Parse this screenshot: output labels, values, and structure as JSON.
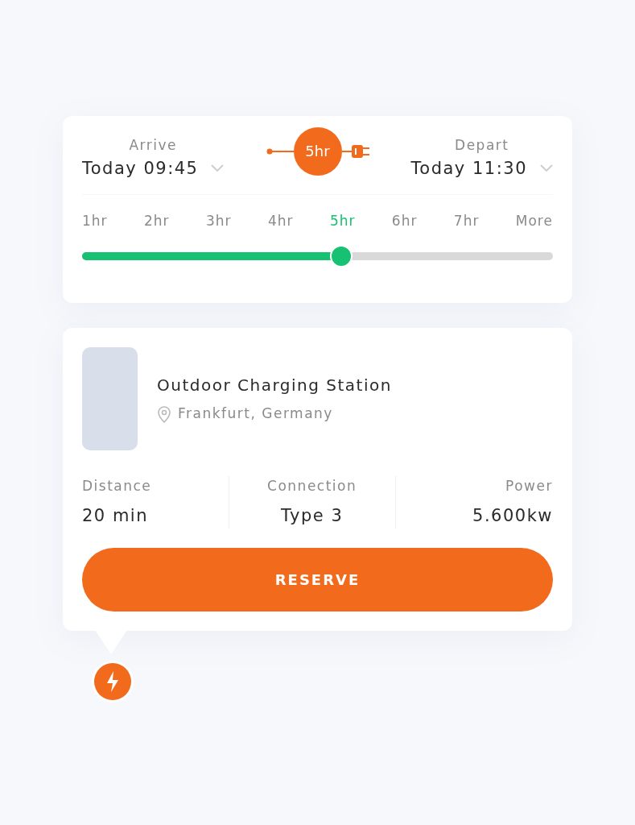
{
  "arrive": {
    "label": "Arrive",
    "value": "Today 09:45"
  },
  "duration_badge": "5hr",
  "depart": {
    "label": "Depart",
    "value": "Today 11:30"
  },
  "durations": [
    {
      "label": "1hr",
      "selected": false
    },
    {
      "label": "2hr",
      "selected": false
    },
    {
      "label": "3hr",
      "selected": false
    },
    {
      "label": "4hr",
      "selected": false
    },
    {
      "label": "5hr",
      "selected": true
    },
    {
      "label": "6hr",
      "selected": false
    },
    {
      "label": "7hr",
      "selected": false
    },
    {
      "label": "More",
      "selected": false
    }
  ],
  "slider": {
    "level": 0.55
  },
  "station": {
    "name": "Outdoor Charging Station",
    "location": "Frankfurt, Germany",
    "stats": [
      {
        "label": "Distance",
        "value": "20 min"
      },
      {
        "label": "Connection",
        "value": "Type 3"
      },
      {
        "label": "Power",
        "value": "5.600kw"
      }
    ],
    "button": "RESERVE"
  }
}
